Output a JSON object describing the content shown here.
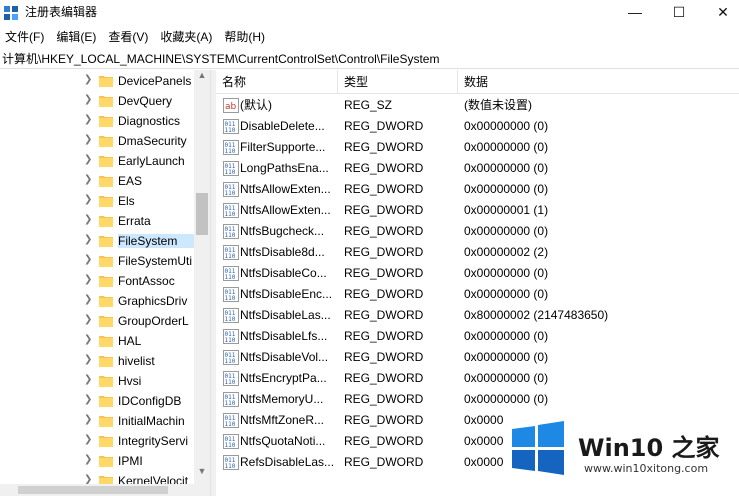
{
  "window": {
    "title": "注册表编辑器",
    "minimize_glyph": "—",
    "maximize_glyph": "☐",
    "close_glyph": "✕",
    "app_icon": "regedit-icon"
  },
  "menu": [
    {
      "label": "文件(F)"
    },
    {
      "label": "编辑(E)"
    },
    {
      "label": "查看(V)"
    },
    {
      "label": "收藏夹(A)"
    },
    {
      "label": "帮助(H)"
    }
  ],
  "address": "计算机\\HKEY_LOCAL_MACHINE\\SYSTEM\\CurrentControlSet\\Control\\FileSystem",
  "tree": {
    "items": [
      {
        "label": "DevicePanels",
        "selected": false
      },
      {
        "label": "DevQuery",
        "selected": false
      },
      {
        "label": "Diagnostics",
        "selected": false
      },
      {
        "label": "DmaSecurity",
        "selected": false
      },
      {
        "label": "EarlyLaunch",
        "selected": false
      },
      {
        "label": "EAS",
        "selected": false
      },
      {
        "label": "Els",
        "selected": false
      },
      {
        "label": "Errata",
        "selected": false
      },
      {
        "label": "FileSystem",
        "selected": true
      },
      {
        "label": "FileSystemUti",
        "selected": false
      },
      {
        "label": "FontAssoc",
        "selected": false
      },
      {
        "label": "GraphicsDriv",
        "selected": false
      },
      {
        "label": "GroupOrderL",
        "selected": false
      },
      {
        "label": "HAL",
        "selected": false
      },
      {
        "label": "hivelist",
        "selected": false
      },
      {
        "label": "Hvsi",
        "selected": false
      },
      {
        "label": "IDConfigDB",
        "selected": false
      },
      {
        "label": "InitialMachin",
        "selected": false
      },
      {
        "label": "IntegrityServi",
        "selected": false
      },
      {
        "label": "IPMI",
        "selected": false
      },
      {
        "label": "KernelVelocit",
        "selected": false
      }
    ]
  },
  "list": {
    "columns": [
      "名称",
      "类型",
      "数据"
    ],
    "rows": [
      {
        "name": "(默认)",
        "type": "REG_SZ",
        "data": "(数值未设置)",
        "icon": "string-value-icon"
      },
      {
        "name": "DisableDelete...",
        "type": "REG_DWORD",
        "data": "0x00000000 (0)",
        "icon": "binary-value-icon"
      },
      {
        "name": "FilterSupporte...",
        "type": "REG_DWORD",
        "data": "0x00000000 (0)",
        "icon": "binary-value-icon"
      },
      {
        "name": "LongPathsEna...",
        "type": "REG_DWORD",
        "data": "0x00000000 (0)",
        "icon": "binary-value-icon"
      },
      {
        "name": "NtfsAllowExten...",
        "type": "REG_DWORD",
        "data": "0x00000000 (0)",
        "icon": "binary-value-icon"
      },
      {
        "name": "NtfsAllowExten...",
        "type": "REG_DWORD",
        "data": "0x00000001 (1)",
        "icon": "binary-value-icon"
      },
      {
        "name": "NtfsBugcheck...",
        "type": "REG_DWORD",
        "data": "0x00000000 (0)",
        "icon": "binary-value-icon"
      },
      {
        "name": "NtfsDisable8d...",
        "type": "REG_DWORD",
        "data": "0x00000002 (2)",
        "icon": "binary-value-icon"
      },
      {
        "name": "NtfsDisableCo...",
        "type": "REG_DWORD",
        "data": "0x00000000 (0)",
        "icon": "binary-value-icon"
      },
      {
        "name": "NtfsDisableEnc...",
        "type": "REG_DWORD",
        "data": "0x00000000 (0)",
        "icon": "binary-value-icon"
      },
      {
        "name": "NtfsDisableLas...",
        "type": "REG_DWORD",
        "data": "0x80000002 (2147483650)",
        "icon": "binary-value-icon"
      },
      {
        "name": "NtfsDisableLfs...",
        "type": "REG_DWORD",
        "data": "0x00000000 (0)",
        "icon": "binary-value-icon"
      },
      {
        "name": "NtfsDisableVol...",
        "type": "REG_DWORD",
        "data": "0x00000000 (0)",
        "icon": "binary-value-icon"
      },
      {
        "name": "NtfsEncryptPa...",
        "type": "REG_DWORD",
        "data": "0x00000000 (0)",
        "icon": "binary-value-icon"
      },
      {
        "name": "NtfsMemoryU...",
        "type": "REG_DWORD",
        "data": "0x00000000 (0)",
        "icon": "binary-value-icon"
      },
      {
        "name": "NtfsMftZoneR...",
        "type": "REG_DWORD",
        "data": "0x0000",
        "icon": "binary-value-icon"
      },
      {
        "name": "NtfsQuotaNoti...",
        "type": "REG_DWORD",
        "data": "0x0000",
        "icon": "binary-value-icon"
      },
      {
        "name": "RefsDisableLas...",
        "type": "REG_DWORD",
        "data": "0x0000",
        "icon": "binary-value-icon"
      }
    ]
  },
  "watermark": {
    "brand": "Win10 之家",
    "url": "www.win10xitong.com",
    "logo_colors": [
      "#1e88e5",
      "#1565c0"
    ]
  }
}
